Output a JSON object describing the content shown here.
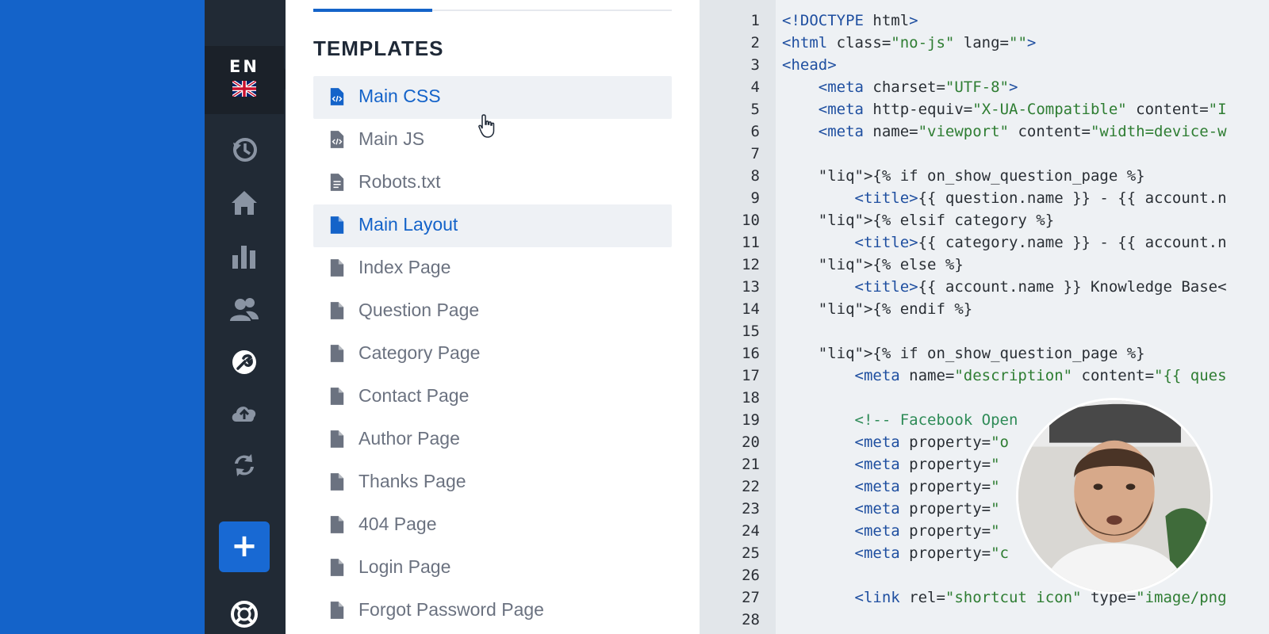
{
  "language": {
    "code": "EN"
  },
  "sidebar": {
    "add_label": "+"
  },
  "templates": {
    "title": "TEMPLATES",
    "items": [
      {
        "label": "Main CSS",
        "icon": "code-file-icon",
        "active": true
      },
      {
        "label": "Main JS",
        "icon": "code-file-icon",
        "active": false
      },
      {
        "label": "Robots.txt",
        "icon": "text-file-icon",
        "active": false
      },
      {
        "label": "Main Layout",
        "icon": "file-icon",
        "active": true
      },
      {
        "label": "Index Page",
        "icon": "file-icon",
        "active": false
      },
      {
        "label": "Question Page",
        "icon": "file-icon",
        "active": false
      },
      {
        "label": "Category Page",
        "icon": "file-icon",
        "active": false
      },
      {
        "label": "Contact Page",
        "icon": "file-icon",
        "active": false
      },
      {
        "label": "Author Page",
        "icon": "file-icon",
        "active": false
      },
      {
        "label": "Thanks Page",
        "icon": "file-icon",
        "active": false
      },
      {
        "label": "404 Page",
        "icon": "file-icon",
        "active": false
      },
      {
        "label": "Login Page",
        "icon": "file-icon",
        "active": false
      },
      {
        "label": "Forgot Password Page",
        "icon": "file-icon",
        "active": false
      }
    ]
  },
  "editor": {
    "lines": [
      {
        "n": "1",
        "text": "<!DOCTYPE html>"
      },
      {
        "n": "2",
        "text": "<html class=\"no-js\" lang=\"\">"
      },
      {
        "n": "3",
        "text": "<head>"
      },
      {
        "n": "4",
        "text": "    <meta charset=\"UTF-8\">"
      },
      {
        "n": "5",
        "text": "    <meta http-equiv=\"X-UA-Compatible\" content=\"I"
      },
      {
        "n": "6",
        "text": "    <meta name=\"viewport\" content=\"width=device-w"
      },
      {
        "n": "7",
        "text": ""
      },
      {
        "n": "8",
        "text": "    {% if on_show_question_page %}"
      },
      {
        "n": "9",
        "text": "        <title>{{ question.name }} - {{ account.n"
      },
      {
        "n": "10",
        "text": "    {% elsif category %}"
      },
      {
        "n": "11",
        "text": "        <title>{{ category.name }} - {{ account.n"
      },
      {
        "n": "12",
        "text": "    {% else %}"
      },
      {
        "n": "13",
        "text": "        <title>{{ account.name }} Knowledge Base<"
      },
      {
        "n": "14",
        "text": "    {% endif %}"
      },
      {
        "n": "15",
        "text": ""
      },
      {
        "n": "16",
        "text": "    {% if on_show_question_page %}"
      },
      {
        "n": "17",
        "text": "        <meta name=\"description\" content=\"{{ ques"
      },
      {
        "n": "18",
        "text": ""
      },
      {
        "n": "19",
        "text": "        <!-- Facebook Open "
      },
      {
        "n": "20",
        "text": "        <meta property=\"o"
      },
      {
        "n": "21",
        "text": "        <meta property=\""
      },
      {
        "n": "22",
        "text": "        <meta property=\""
      },
      {
        "n": "23",
        "text": "        <meta property=\""
      },
      {
        "n": "24",
        "text": "        <meta property=\""
      },
      {
        "n": "25",
        "text": "        <meta property=\"c"
      },
      {
        "n": "26",
        "text": ""
      },
      {
        "n": "27",
        "text": "        <link rel=\"shortcut icon\" type=\"image/png"
      },
      {
        "n": "28",
        "text": ""
      }
    ]
  },
  "colors": {
    "brand_blue": "#1463c9",
    "rail_dark": "#212a35",
    "active_row": "#eef1f5",
    "editor_bg": "#eef1f4"
  }
}
